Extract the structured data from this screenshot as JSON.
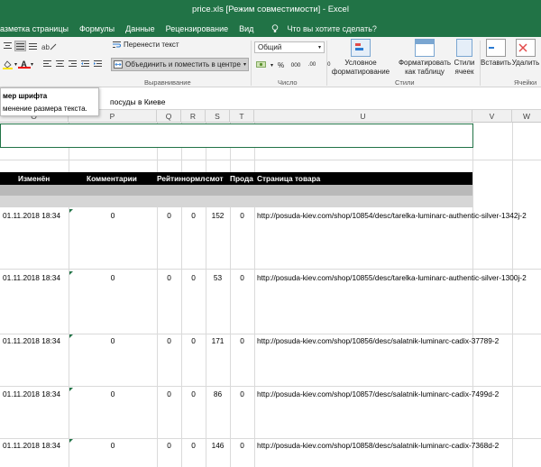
{
  "window": {
    "title": "price.xls  [Режим совместимости] - Excel"
  },
  "menu": {
    "items": [
      "азметка страницы",
      "Формулы",
      "Данные",
      "Рецензирование",
      "Вид"
    ],
    "tellme": "Что вы хотите сделать?"
  },
  "ribbon": {
    "wrap_text": "Перенести текст",
    "merge_center": "Объединить и поместить в центре",
    "number_format": "Общий",
    "currency_symbol": "%",
    "comma": "000",
    "decimal_inc": ".00",
    "decimal_dec": ".0",
    "cond_format": "Условное\nформатирование",
    "format_table": "Форматировать\nкак таблицу",
    "cell_styles": "Стили\nячеек",
    "insert": "Вставить",
    "delete": "Удалить",
    "group_align": "Выравнивание",
    "group_number": "Число",
    "group_styles": "Стили",
    "group_cells": "Ячейки",
    "font_color_letter": "A"
  },
  "tooltip": {
    "title": "мер шрифта",
    "desc": "менение размера текста."
  },
  "formula_bar": {
    "content": "посуды в Киеве"
  },
  "columns": [
    "O",
    "P",
    "Q",
    "R",
    "S",
    "T",
    "U",
    "V",
    "W"
  ],
  "table": {
    "headers": [
      "Изменён",
      "Комментарии",
      "Рейтин",
      "нормле",
      "смот",
      "Прода",
      "Страница товара"
    ],
    "rows": [
      {
        "date": "01.11.2018 18:34",
        "comments": "0",
        "q": "0",
        "r": "0",
        "s": "152",
        "t": "0",
        "url": "http://posuda-kiev.com/shop/10854/desc/tarelka-luminarc-authentic-silver-1342j-2"
      },
      {
        "date": "01.11.2018 18:34",
        "comments": "0",
        "q": "0",
        "r": "0",
        "s": "53",
        "t": "0",
        "url": "http://posuda-kiev.com/shop/10855/desc/tarelka-luminarc-authentic-silver-1300j-2"
      },
      {
        "date": "01.11.2018 18:34",
        "comments": "0",
        "q": "0",
        "r": "0",
        "s": "171",
        "t": "0",
        "url": "http://posuda-kiev.com/shop/10856/desc/salatnik-luminarc-cadix-37789-2"
      },
      {
        "date": "01.11.2018 18:34",
        "comments": "0",
        "q": "0",
        "r": "0",
        "s": "86",
        "t": "0",
        "url": "http://posuda-kiev.com/shop/10857/desc/salatnik-luminarc-cadix-7499d-2"
      },
      {
        "date": "01.11.2018 18:34",
        "comments": "0",
        "q": "0",
        "r": "0",
        "s": "146",
        "t": "0",
        "url": "http://posuda-kiev.com/shop/10858/desc/salatnik-luminarc-cadix-7368d-2"
      }
    ]
  },
  "colors": {
    "excel_green": "#217346",
    "header_black": "#000000",
    "band_gray": "#b9b9b9",
    "band_light": "#d6d6d6"
  }
}
